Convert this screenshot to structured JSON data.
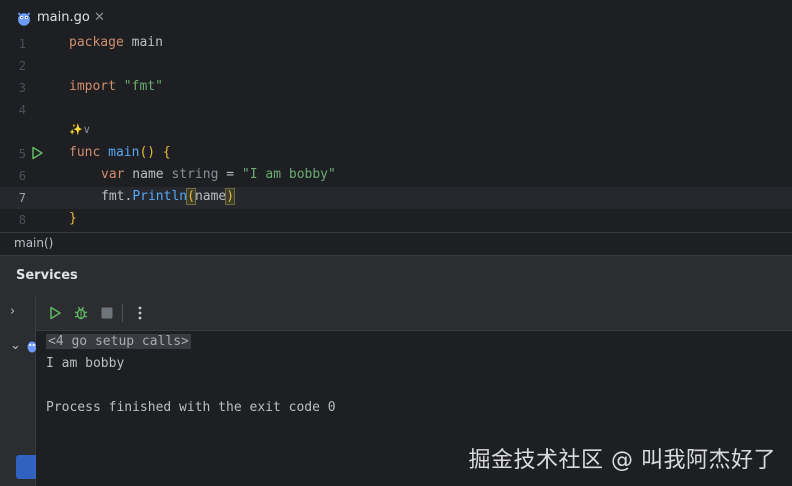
{
  "tab": {
    "filename": "main.go",
    "close_glyph": "✕",
    "icon": "go-gopher-icon"
  },
  "editor": {
    "lines": [
      {
        "num": "1",
        "tokens": [
          "package",
          " main"
        ]
      },
      {
        "num": "2"
      },
      {
        "num": "3",
        "tokens": [
          "import",
          " \"fmt\""
        ]
      },
      {
        "num": "4"
      },
      {
        "num": "5",
        "tokens": [
          "func",
          " ",
          "main",
          "() {"
        ]
      },
      {
        "num": "6",
        "tokens": [
          "var",
          " name ",
          "string",
          " = ",
          "\"I am bobby\""
        ]
      },
      {
        "num": "7",
        "tokens": [
          "fmt",
          ".",
          "Println",
          "(",
          "name",
          ")"
        ]
      },
      {
        "num": "8",
        "tokens": [
          "}"
        ]
      }
    ],
    "inlay_hint": "✨∨",
    "current_line": "7"
  },
  "breadcrumb": "main()",
  "services": {
    "title": "Services",
    "toolbar": {
      "run_icon": "run-icon",
      "debug_icon": "debug-icon",
      "stop_icon": "stop-icon",
      "more_icon": "more-options-icon"
    },
    "console": {
      "folded_line": "<4 go setup calls>",
      "output_line": "I am bobby",
      "exit_line": "Process finished with the exit code 0"
    }
  },
  "watermark": "掘金技术社区 @ 叫我阿杰好了",
  "colors": {
    "accent": "#3574f0",
    "run_green": "#5fb865",
    "keyword": "#cf8e6d",
    "string": "#6aab73",
    "function": "#56a8f5"
  }
}
